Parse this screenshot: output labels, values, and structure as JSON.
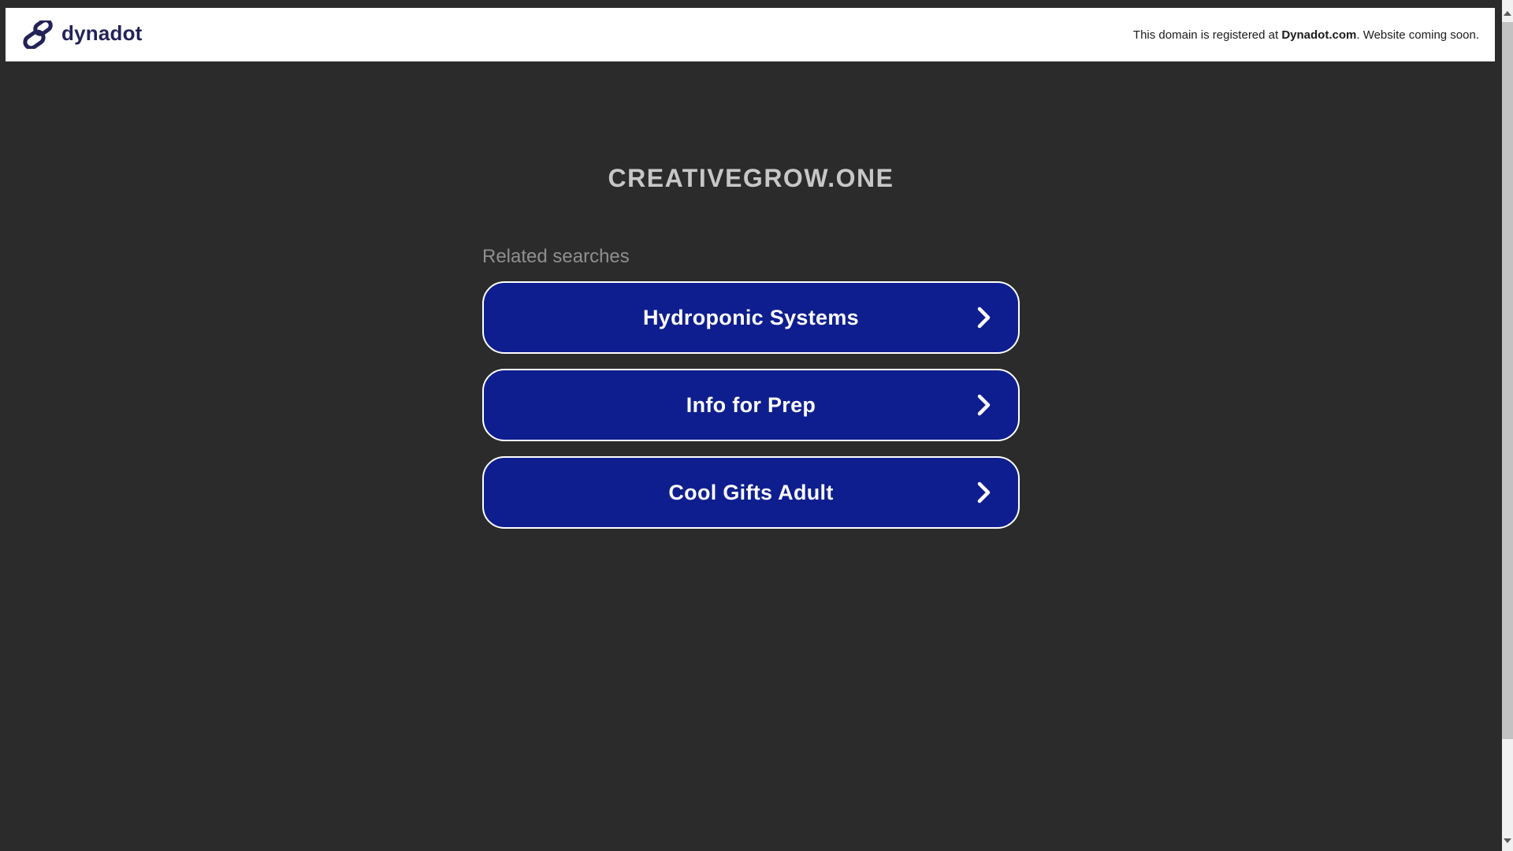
{
  "header": {
    "logo_text": "dynadot",
    "notice": {
      "prefix": "This domain is registered at ",
      "bold": "Dynadot.com",
      "suffix": ". Website coming soon."
    }
  },
  "main": {
    "domain_title": "CREATIVEGROW.ONE",
    "related_label": "Related searches",
    "related_searches": [
      {
        "label": "Hydroponic Systems"
      },
      {
        "label": "Info for Prep"
      },
      {
        "label": "Cool Gifts Adult"
      }
    ]
  },
  "colors": {
    "page_bg": "#2b2b2b",
    "button_blue": "#0f1e8e",
    "button_border": "#ffffff",
    "logo_navy": "#232258",
    "title_gray": "#c7c7c7",
    "label_gray": "#8f8f8f",
    "scrollbar_track": "#f1f1f1",
    "scrollbar_thumb": "#c2c2c2"
  },
  "icons": {
    "logo": "chain-link-icon",
    "button_arrow": "chevron-right-icon",
    "scroll_up": "triangle-up-icon",
    "scroll_down": "triangle-down-icon"
  }
}
